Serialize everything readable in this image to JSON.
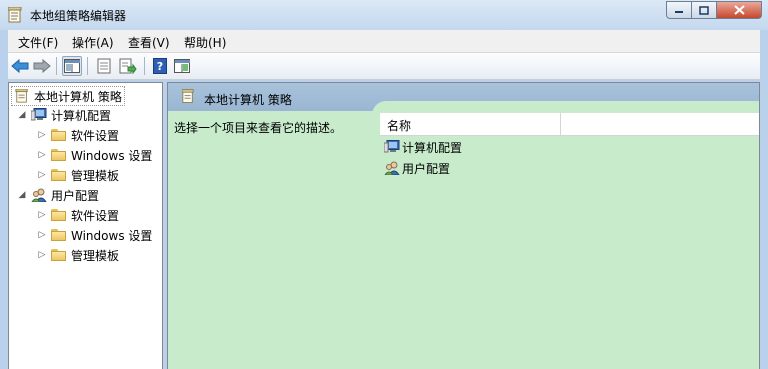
{
  "window": {
    "title": "本地组策略编辑器",
    "icon": "policy-document-icon"
  },
  "menu": {
    "items": [
      "文件(F)",
      "操作(A)",
      "查看(V)",
      "帮助(H)"
    ]
  },
  "toolbar": {
    "buttons": [
      "back-arrow-icon",
      "forward-arrow-icon",
      "show-hide-tree-icon",
      "properties-icon",
      "export-list-icon",
      "help-icon",
      "show-hide-action-pane-icon"
    ]
  },
  "tree": {
    "root": "本地计算机 策略",
    "computer": {
      "label": "计算机配置",
      "children": [
        "软件设置",
        "Windows 设置",
        "管理模板"
      ]
    },
    "user": {
      "label": "用户配置",
      "children": [
        "软件设置",
        "Windows 设置",
        "管理模板"
      ]
    }
  },
  "content": {
    "header": "本地计算机 策略",
    "description": "选择一个项目来查看它的描述。",
    "columns": [
      "名称",
      ""
    ],
    "rows": [
      "计算机配置",
      "用户配置"
    ]
  },
  "colors": {
    "content_bg": "#c8ebcc",
    "header_bg": "#9ab6d2",
    "titlebar": "#c4d8ee"
  }
}
